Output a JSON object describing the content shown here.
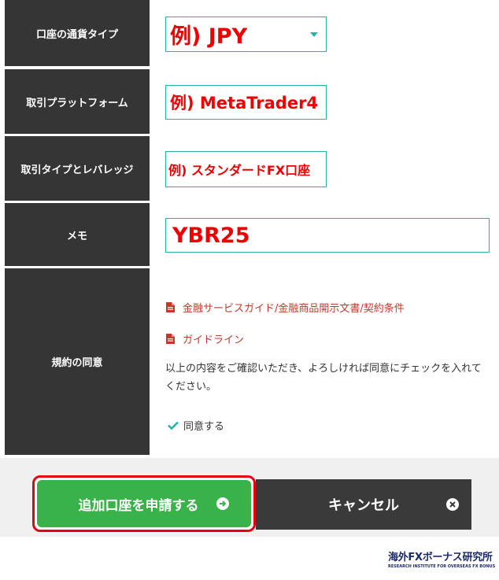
{
  "form": {
    "currency": {
      "label": "口座の通貨タイプ",
      "value": "例) JPY"
    },
    "platform": {
      "label": "取引プラットフォーム",
      "value": "例) MetaTrader4"
    },
    "type_leverage": {
      "label": "取引タイプとレバレッジ",
      "value": "例) スタンダードFX口座"
    },
    "memo": {
      "label": "メモ",
      "value": "YBR25"
    },
    "agreement": {
      "label": "規約の同意",
      "links": [
        "金融サービスガイド/金融商品開示文書/契約条件",
        "ガイドライン"
      ],
      "text": "以上の内容をご確認いただき、よろしければ同意にチェックを入れてください。",
      "checkbox_label": "同意する"
    }
  },
  "actions": {
    "apply": "追加口座を申請する",
    "cancel": "キャンセル"
  },
  "watermark": {
    "main": "海外FXボーナス研究所",
    "sub": "RESEARCH INSTITUTE FOR OVERSEAS FX BONUS"
  },
  "colors": {
    "label_bg": "#353535",
    "field_border": "#27b3a7",
    "placeholder_red": "#ee0000",
    "link_red": "#c0392b",
    "apply_green": "#3ab24a",
    "highlight_red": "#e60012"
  }
}
